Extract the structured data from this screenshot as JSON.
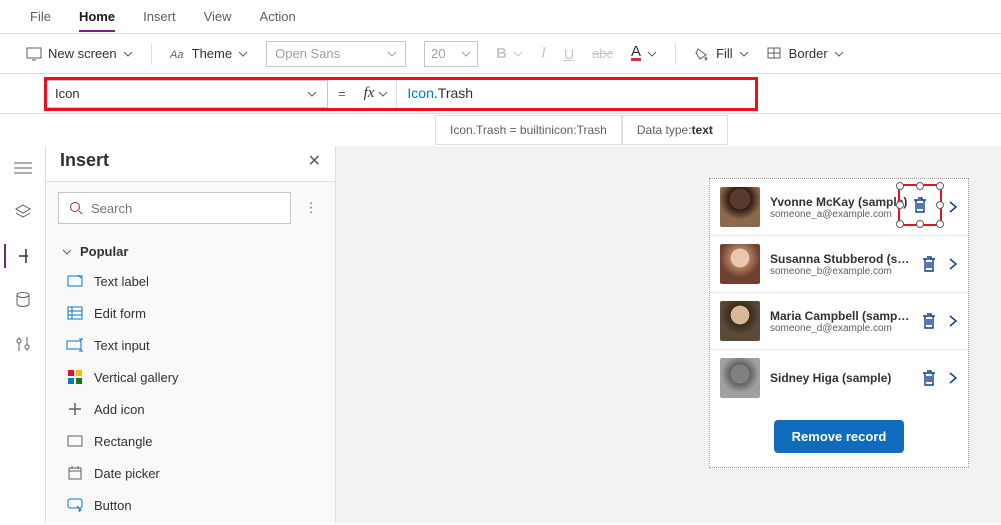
{
  "menubar": {
    "items": [
      "File",
      "Home",
      "Insert",
      "View",
      "Action"
    ],
    "active": 1
  },
  "toolbar": {
    "newscreen": "New screen",
    "theme": "Theme",
    "font": "Open Sans",
    "size": "20",
    "fill": "Fill",
    "border": "Border"
  },
  "formula": {
    "property": "Icon",
    "expression_prefix": "Icon",
    "expression_suffix": ".Trash",
    "result_text": "Icon.Trash  =  builtinicon:Trash",
    "datatype_label": "Data type: ",
    "datatype_value": "text"
  },
  "panel": {
    "title": "Insert",
    "search_placeholder": "Search",
    "group": "Popular",
    "items": [
      "Text label",
      "Edit form",
      "Text input",
      "Vertical gallery",
      "Add icon",
      "Rectangle",
      "Date picker",
      "Button"
    ]
  },
  "gallery": {
    "rows": [
      {
        "name": "Yvonne McKay (sample)",
        "email": "someone_a@example.com"
      },
      {
        "name": "Susanna Stubberod (sample)",
        "email": "someone_b@example.com"
      },
      {
        "name": "Maria Campbell (sample)",
        "email": "someone_d@example.com"
      },
      {
        "name": "Sidney Higa (sample)",
        "email": ""
      }
    ],
    "button": "Remove record"
  }
}
